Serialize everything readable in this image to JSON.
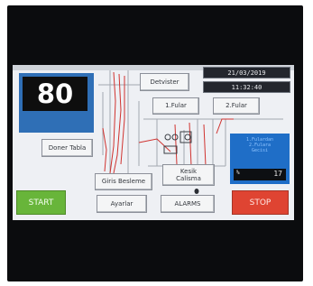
{
  "counter": {
    "value": "80"
  },
  "header": {
    "date": "21/03/2019",
    "time": "11:32:40",
    "detwister_label": "Detvister"
  },
  "fulars": {
    "fular1_label": "1.Fular",
    "fular2_label": "2.Fular"
  },
  "buttons": {
    "doner_tabla": "Doner Tabla",
    "giris_besleme": "Giris Besleme",
    "kesik_calisma_line1": "Kesik",
    "kesik_calisma_line2": "Calisma",
    "ayarlar": "Ayarlar",
    "alarms": "ALARMS",
    "start": "START",
    "stop": "STOP"
  },
  "status_panel": {
    "line1": "1.Fulardan",
    "line2": "2.Fulara",
    "line3": "Gecisi",
    "unit": "%",
    "value": "17"
  },
  "colors": {
    "counter_bg": "#2f6fb6",
    "start_green": "#68b53a",
    "stop_red": "#df4432",
    "status_blue": "#1f6ec7",
    "pipe_red": "#d0322f"
  },
  "icons": [
    "roller-icon",
    "cursor-icon"
  ]
}
